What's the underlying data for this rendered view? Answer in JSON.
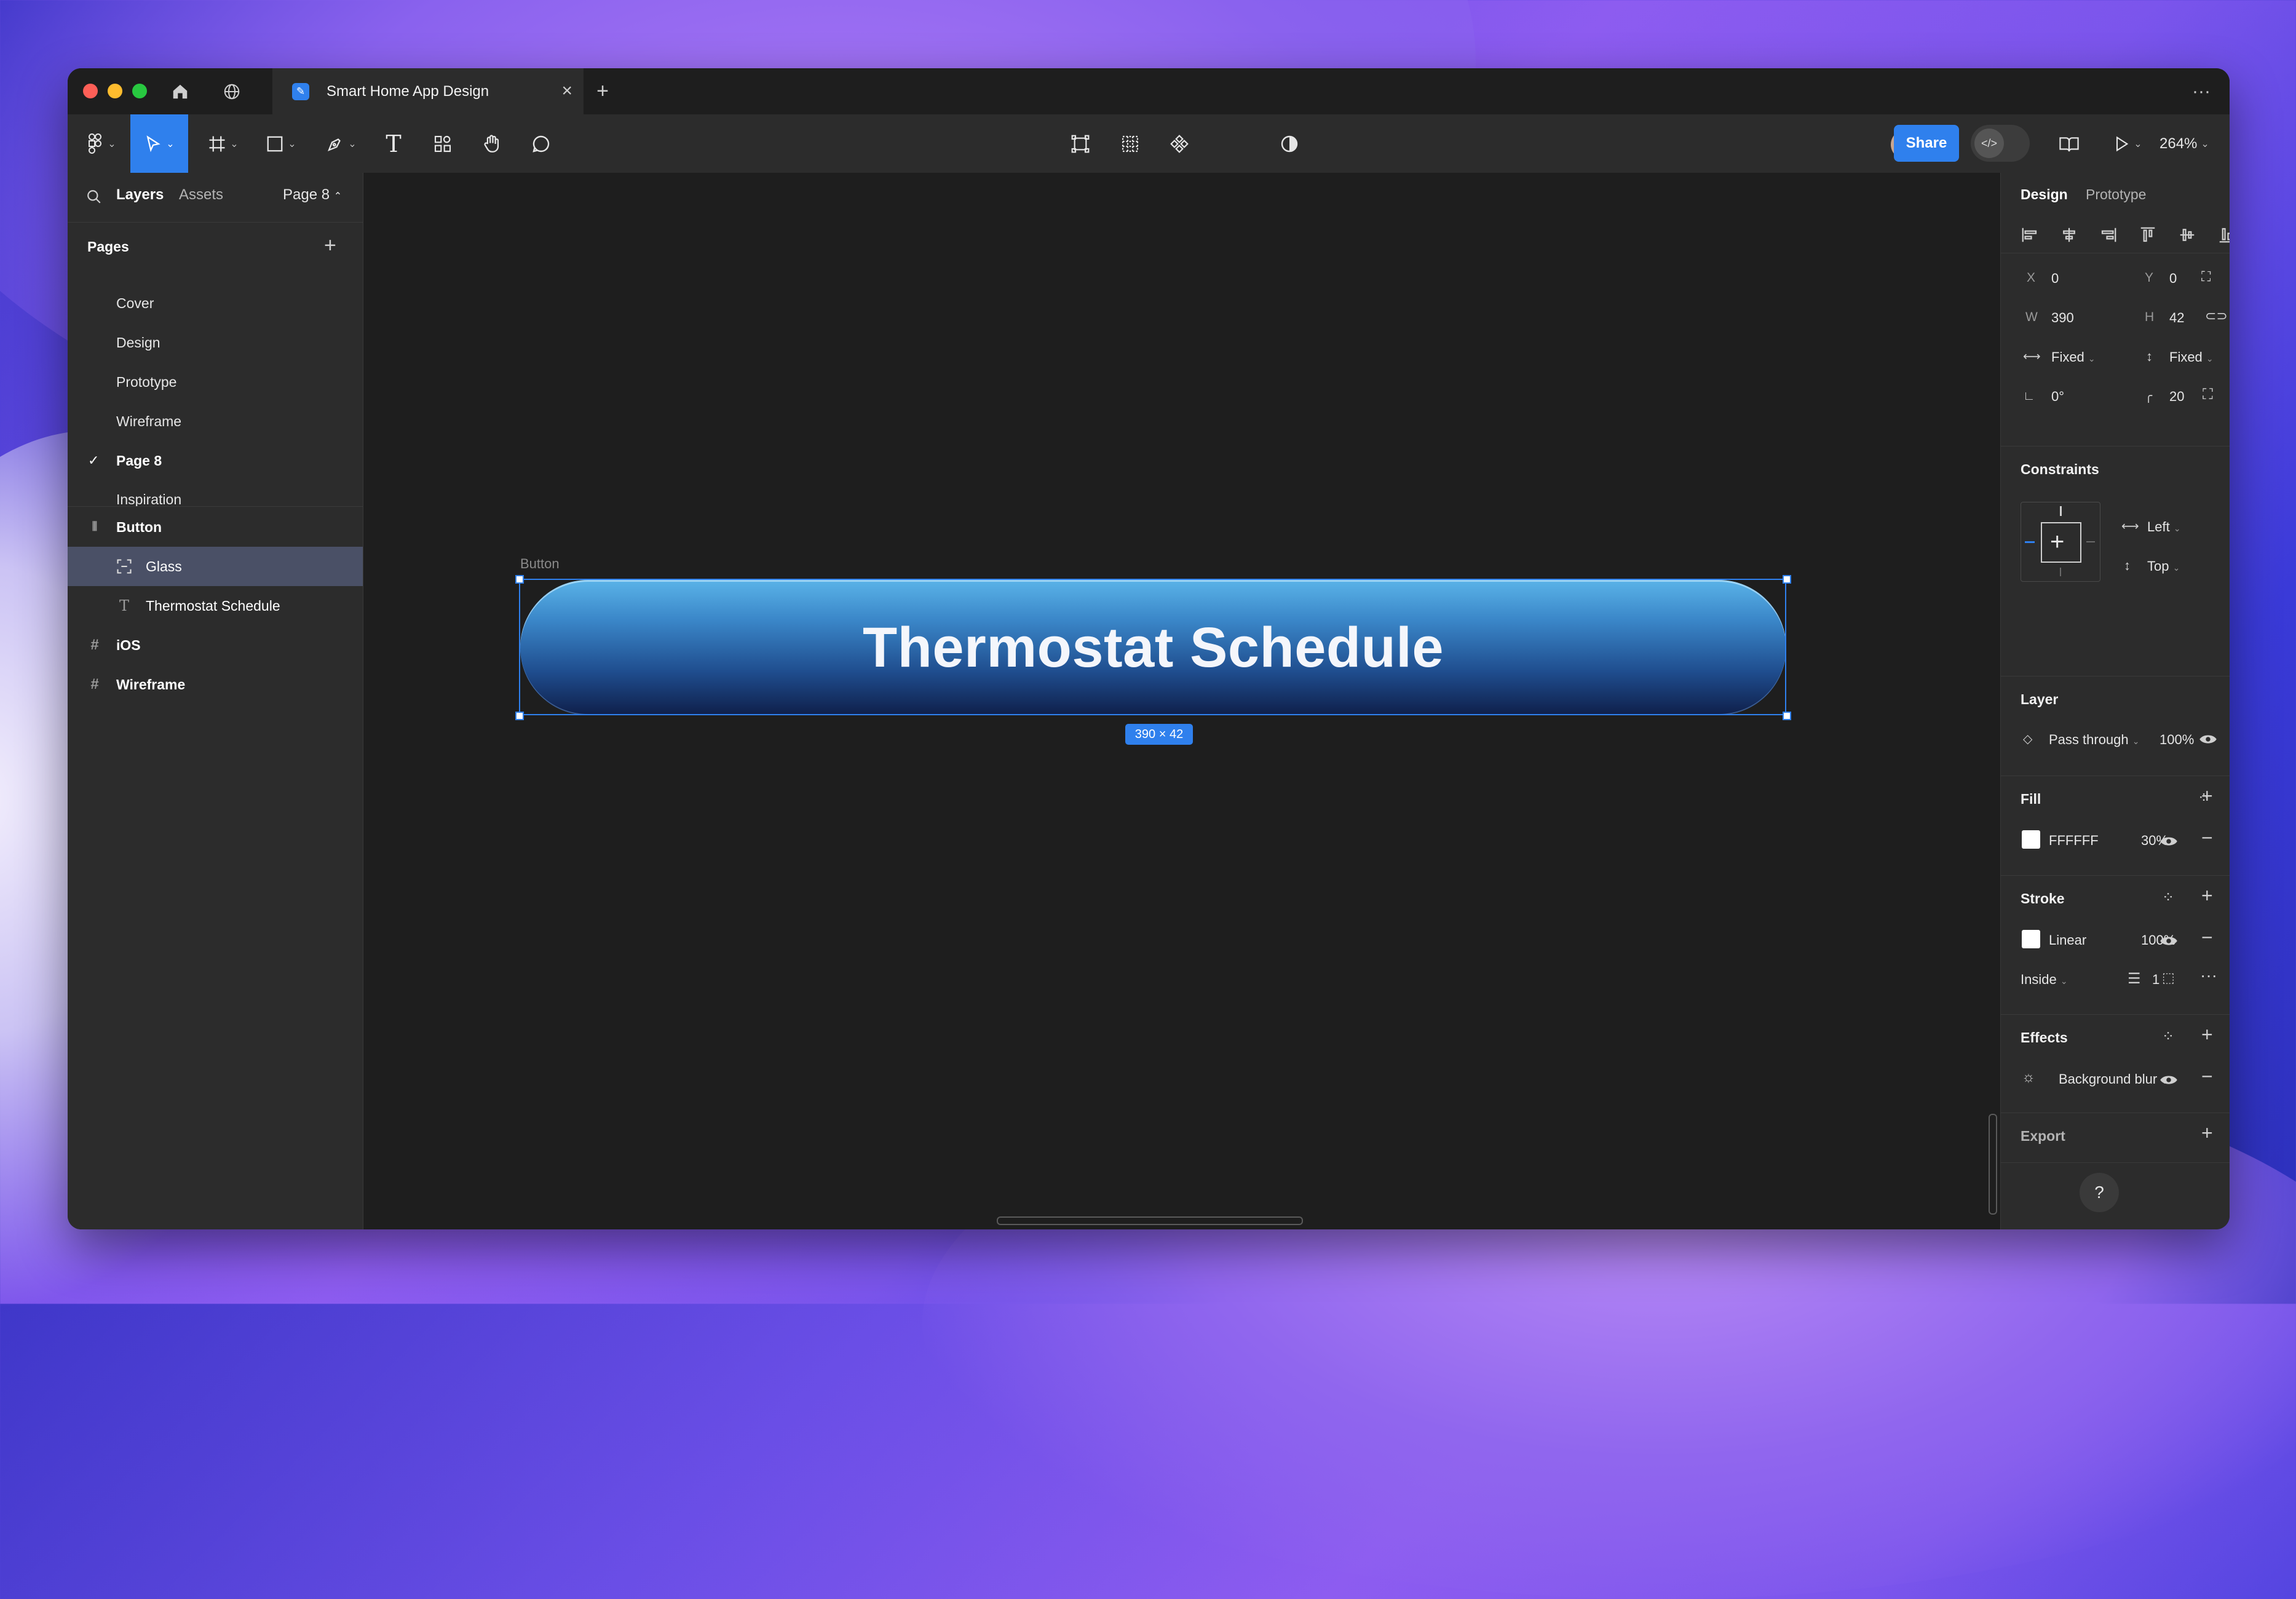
{
  "window": {
    "tab_title": "Smart Home App Design",
    "new_tab": "+",
    "more": "···"
  },
  "toolbar": {
    "share_label": "Share",
    "zoom_label": "264%",
    "accent": "#2F80ED"
  },
  "left_panel": {
    "tabs": [
      "Layers",
      "Assets"
    ],
    "current_page": "Page 8",
    "pages_title": "Pages",
    "pages": [
      {
        "label": "Cover",
        "checked": false
      },
      {
        "label": "Design",
        "checked": false
      },
      {
        "label": "Prototype",
        "checked": false
      },
      {
        "label": "Wireframe",
        "checked": false
      },
      {
        "label": "Page 8",
        "checked": true
      },
      {
        "label": "Inspiration",
        "checked": false
      }
    ],
    "layers": [
      {
        "label": "Button",
        "icon": "auto-layout-icon",
        "bold": true
      },
      {
        "label": "Glass",
        "icon": "frame-icon",
        "selected": true
      },
      {
        "label": "Thermostat Schedule",
        "icon": "text-icon"
      },
      {
        "label": "iOS",
        "icon": "frame-hash-icon",
        "bold": true
      },
      {
        "label": "Wireframe",
        "icon": "frame-hash-icon",
        "bold": true
      }
    ]
  },
  "canvas": {
    "frame_label": "Button",
    "button_text": "Thermostat Schedule",
    "size_badge": "390 × 42"
  },
  "right_panel": {
    "tabs": [
      "Design",
      "Prototype"
    ],
    "x_label": "X",
    "x": "0",
    "y_label": "Y",
    "y": "0",
    "w_label": "W",
    "w": "390",
    "h_label": "H",
    "h": "42",
    "h_sizing": "Fixed",
    "v_sizing": "Fixed",
    "rotation": "0°",
    "radius": "20",
    "constraints_title": "Constraints",
    "constraint_h": "Left",
    "constraint_v": "Top",
    "layer_title": "Layer",
    "blend_mode": "Pass through",
    "layer_opacity": "100%",
    "fill_title": "Fill",
    "fill_hex": "FFFFFF",
    "fill_opacity": "30%",
    "stroke_title": "Stroke",
    "stroke_type": "Linear",
    "stroke_opacity": "100%",
    "stroke_position": "Inside",
    "stroke_weight": "1",
    "effects_title": "Effects",
    "effect_name": "Background blur",
    "export_title": "Export",
    "help": "?"
  }
}
